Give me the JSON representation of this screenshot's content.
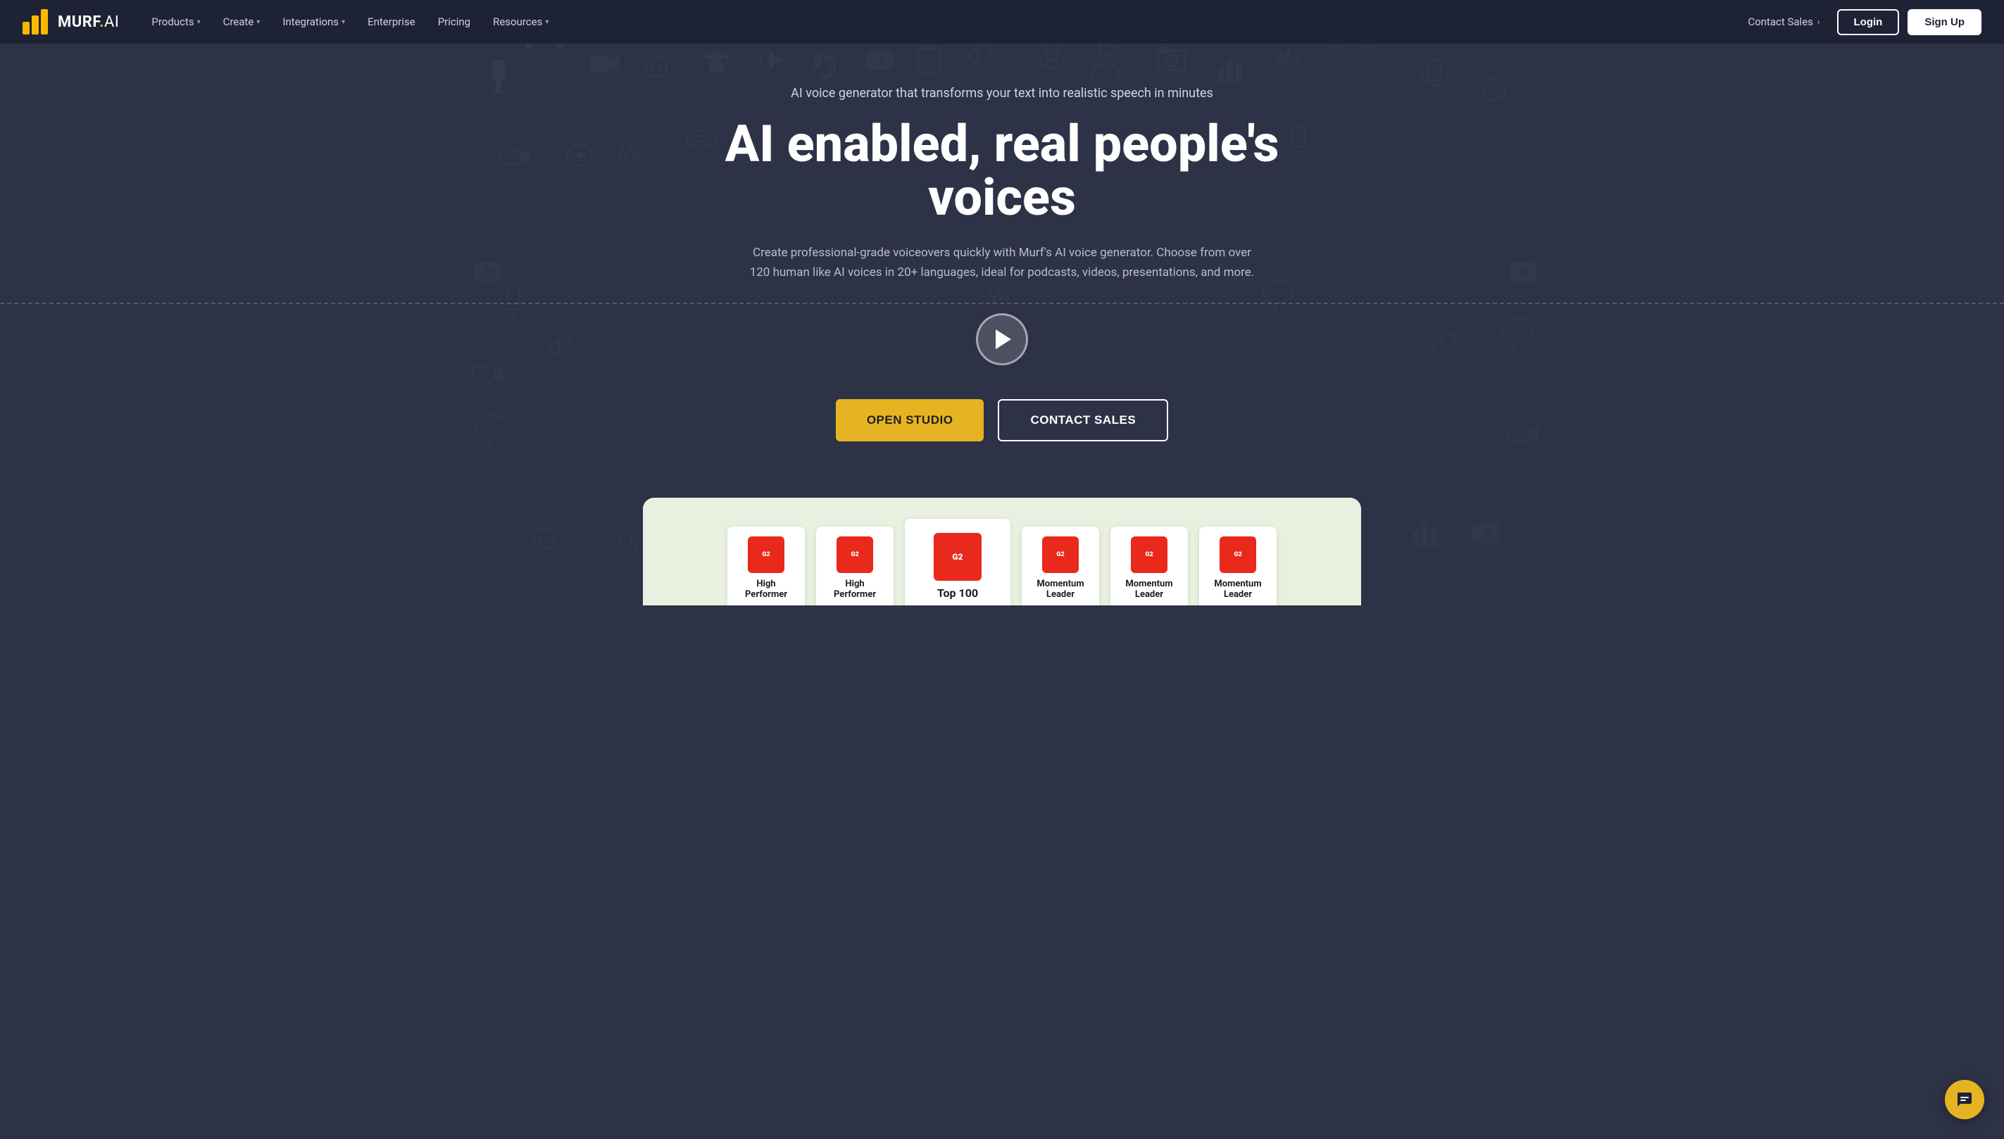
{
  "nav": {
    "logo_alt": "Murf AI",
    "items": [
      {
        "label": "Products",
        "has_dropdown": true
      },
      {
        "label": "Create",
        "has_dropdown": true
      },
      {
        "label": "Integrations",
        "has_dropdown": true
      },
      {
        "label": "Enterprise",
        "has_dropdown": false
      },
      {
        "label": "Pricing",
        "has_dropdown": false
      },
      {
        "label": "Resources",
        "has_dropdown": true
      }
    ],
    "contact_sales": "Contact Sales",
    "login": "Login",
    "signup": "Sign Up"
  },
  "hero": {
    "subtitle": "AI voice generator that transforms your text into realistic speech in minutes",
    "title": "AI enabled, real people's voices",
    "description": "Create professional-grade voiceovers quickly with Murf's AI voice generator. Choose from over 120 human like AI voices in 20+ languages, ideal for podcasts, videos, presentations, and more.",
    "cta_primary": "OPEN STUDIO",
    "cta_secondary": "CONTACT SALES"
  },
  "awards": [
    {
      "label": "High\nPerformer",
      "size": "normal"
    },
    {
      "label": "High\nPerformer",
      "size": "normal"
    },
    {
      "label": "Top 100",
      "size": "featured"
    },
    {
      "label": "Momentum\nLeader",
      "size": "normal"
    },
    {
      "label": "Momentum\nLeader",
      "size": "normal"
    },
    {
      "label": "G2",
      "size": "small"
    }
  ],
  "chat": {
    "icon": "💬"
  }
}
